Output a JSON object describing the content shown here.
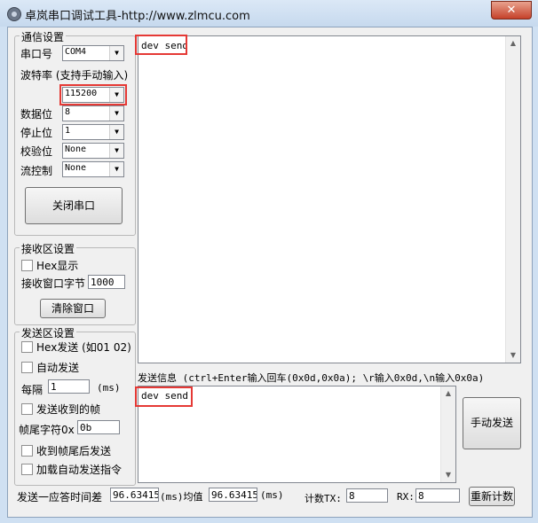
{
  "window": {
    "title": "卓岚串口调试工具-http://www.zlmcu.com",
    "close_label": "✕"
  },
  "comm": {
    "group_label": "通信设置",
    "port_label": "串口号",
    "port_value": "COM4",
    "baud_label": "波特率 (支持手动输入)",
    "baud_value": "115200",
    "databits_label": "数据位",
    "databits_value": "8",
    "stopbits_label": "停止位",
    "stopbits_value": "1",
    "parity_label": "校验位",
    "parity_value": "None",
    "flow_label": "流控制",
    "flow_value": "None",
    "close_port_label": "关闭串口"
  },
  "receive": {
    "group_label": "接收区设置",
    "hex_display_label": "Hex显示",
    "window_bytes_label": "接收窗口字节",
    "window_bytes_value": "1000",
    "clear_label": "清除窗口"
  },
  "send": {
    "group_label": "发送区设置",
    "hex_send_label": "Hex发送 (如01 02)",
    "auto_send_label": "自动发送",
    "interval_label": "每隔",
    "interval_value": "1",
    "interval_unit": "(ms)",
    "send_on_receive_label": "发送收到的帧",
    "tail_label": "帧尾字符0x",
    "tail_value": "0b",
    "send_after_tail_label": "收到帧尾后发送",
    "load_auto_label": "加载自动发送指令"
  },
  "receive_area": {
    "text": "dev send"
  },
  "send_info": {
    "hint": "发送信息 (ctrl+Enter输入回车(0x0d,0x0a); \\r输入0x0d,\\n输入0x0a)",
    "text": "dev send",
    "manual_send_label": "手动发送"
  },
  "footer": {
    "response_label": "发送一应答时间差",
    "response_value": "96.63415",
    "ms_avg_label": "(ms)均值",
    "avg_value": "96.63415",
    "ms_label": "(ms)",
    "count_tx_label": "计数TX:",
    "count_tx_value": "8",
    "rx_label": "RX:",
    "rx_value": "8",
    "reset_label": "重新计数"
  },
  "colors": {
    "highlight": "#e53935",
    "window_frame": "#cfe0f2"
  }
}
